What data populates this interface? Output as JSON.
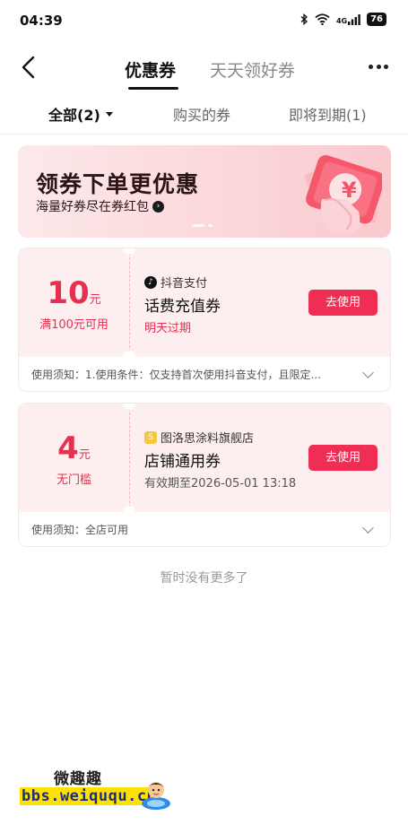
{
  "status_bar": {
    "time": "04:39",
    "network": "4G",
    "battery": "76"
  },
  "header": {
    "tabs": [
      {
        "label": "优惠券"
      },
      {
        "label": "天天领好券"
      }
    ]
  },
  "filters": [
    {
      "label": "全部(2)"
    },
    {
      "label": "购买的券"
    },
    {
      "label": "即将到期(1)"
    }
  ],
  "banner": {
    "title": "领券下单更优惠",
    "subtitle": "海量好券尽在券红包",
    "badge_symbol": "¥"
  },
  "coupons": [
    {
      "amount": "10",
      "unit": "元",
      "condition": "满100元可用",
      "shop": "抖音支付",
      "shop_icon": "douyin-icon",
      "name": "话费充值券",
      "expire": "明天过期",
      "expire_color": "#e6304f",
      "button": "去使用",
      "notice": "使用须知：1.使用条件：仅支持首次使用抖音支付，且限定..."
    },
    {
      "amount": "4",
      "unit": "元",
      "condition": "无门槛",
      "shop": "图洛思涂料旗舰店",
      "shop_icon": "store-icon",
      "name": "店铺通用券",
      "expire": "有效期至2026-05-01 13:18",
      "expire_color": "#555555",
      "button": "去使用",
      "notice": "使用须知：全店可用"
    }
  ],
  "footer": {
    "no_more": "暂时没有更多了"
  },
  "watermark": {
    "title": "微趣趣",
    "url": "bbs.weiququ.cn"
  },
  "colors": {
    "accent": "#f02d52",
    "coupon_bg": "#fdeeef",
    "price": "#e6304f"
  }
}
